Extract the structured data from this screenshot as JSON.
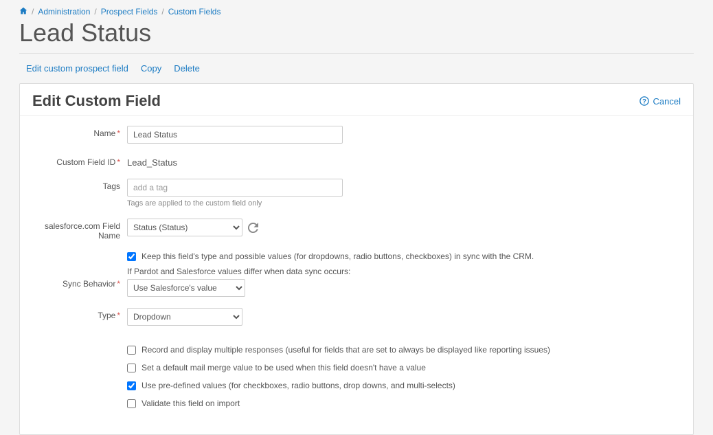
{
  "breadcrumb": {
    "admin": "Administration",
    "prospect_fields": "Prospect Fields",
    "custom_fields": "Custom Fields"
  },
  "page_title": "Lead Status",
  "actions": {
    "edit": "Edit custom prospect field",
    "copy": "Copy",
    "delete": "Delete"
  },
  "card": {
    "title": "Edit Custom Field",
    "cancel": "Cancel"
  },
  "form": {
    "name": {
      "label": "Name",
      "value": "Lead Status"
    },
    "custom_field_id": {
      "label": "Custom Field ID",
      "value": "Lead_Status"
    },
    "tags": {
      "label": "Tags",
      "placeholder": "add a tag",
      "hint": "Tags are applied to the custom field only"
    },
    "sf_field": {
      "label": "salesforce.com Field Name",
      "selected": "Status (Status)"
    },
    "keep_sync": {
      "text": "Keep this field's type and possible values (for dropdowns, radio buttons, checkboxes) in sync with the CRM."
    },
    "sync_behavior": {
      "label": "Sync Behavior",
      "hint": "If Pardot and Salesforce values differ when data sync occurs:",
      "selected": "Use Salesforce's value"
    },
    "type": {
      "label": "Type",
      "selected": "Dropdown"
    },
    "opts": {
      "multiple": "Record and display multiple responses (useful for fields that are set to always be displayed like reporting issues)",
      "default_merge": "Set a default mail merge value to be used when this field doesn't have a value",
      "predefined": "Use pre-defined values (for checkboxes, radio buttons, drop downs, and multi-selects)",
      "validate": "Validate this field on import"
    }
  }
}
